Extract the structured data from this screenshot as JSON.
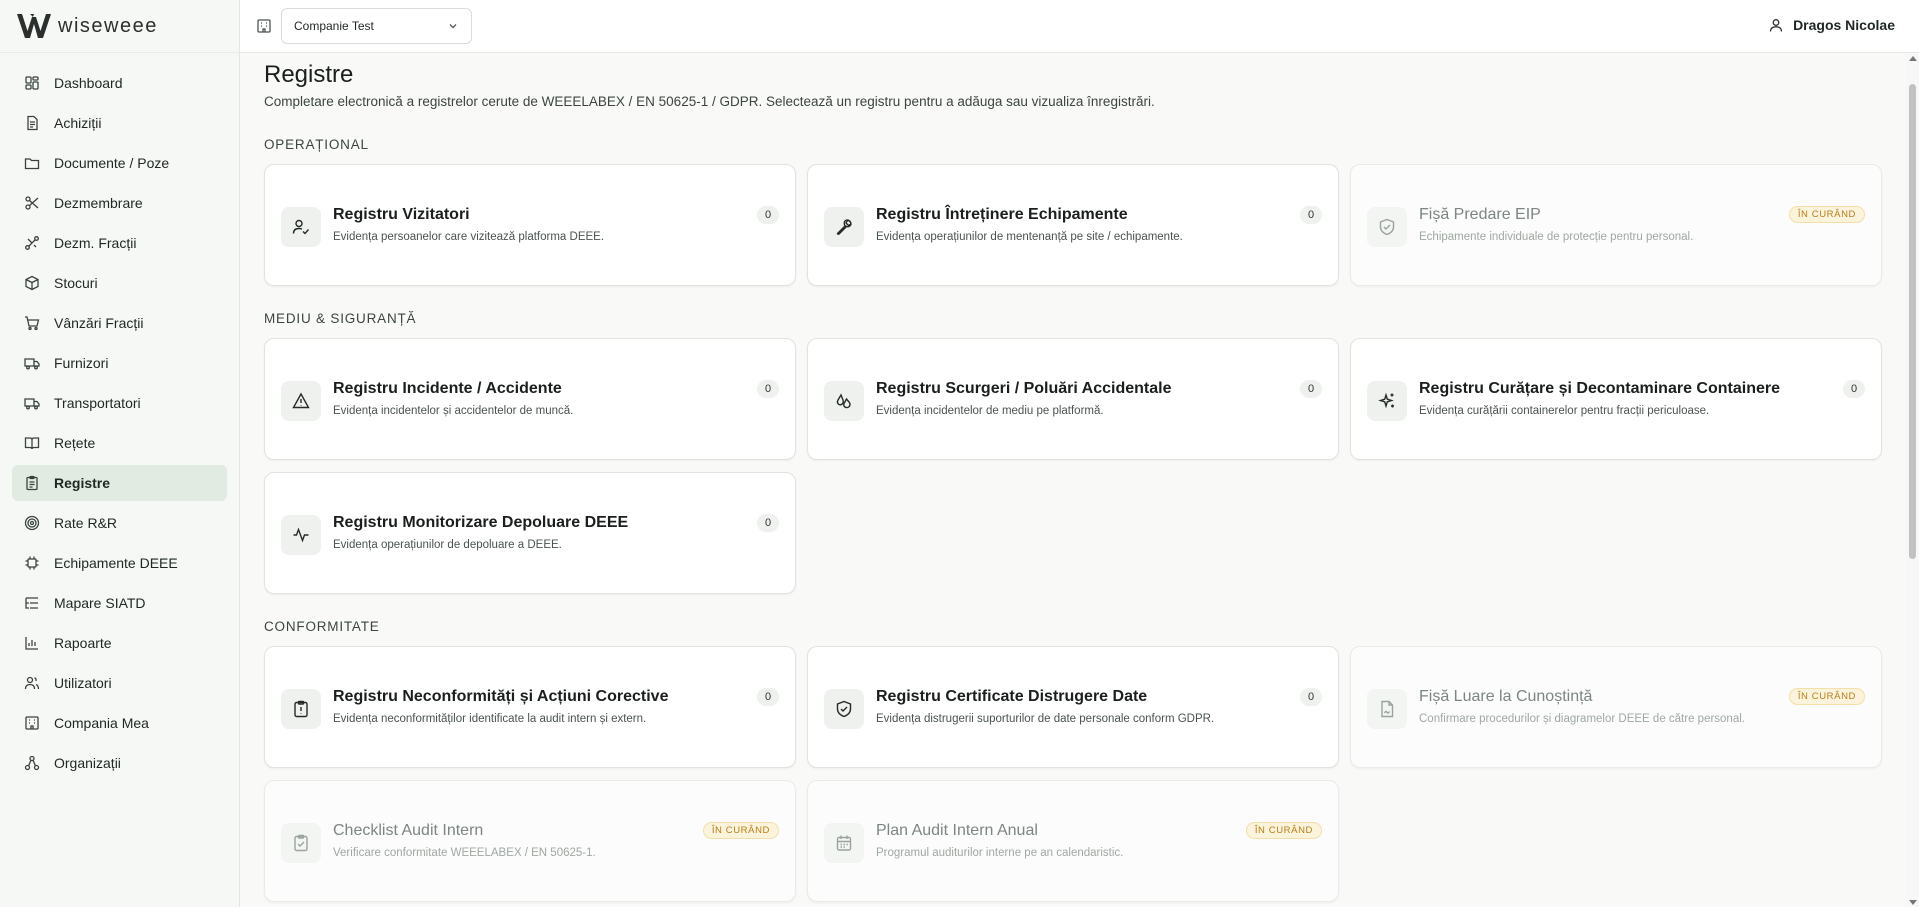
{
  "app": {
    "name": "wiseweee"
  },
  "colors": {
    "active_nav": "#e1ebe1",
    "soon_badge_text": "#b7801a",
    "soon_badge_bg": "#fcf3dc"
  },
  "sidebar": {
    "items": [
      {
        "label": "Dashboard",
        "icon": "dashboard-icon"
      },
      {
        "label": "Achiziții",
        "icon": "document-icon"
      },
      {
        "label": "Documente / Poze",
        "icon": "folder-icon"
      },
      {
        "label": "Dezmembrare",
        "icon": "scissors-icon"
      },
      {
        "label": "Dezm. Fracții",
        "icon": "split-icon"
      },
      {
        "label": "Stocuri",
        "icon": "box-icon"
      },
      {
        "label": "Vânzări Fracții",
        "icon": "cart-icon"
      },
      {
        "label": "Furnizori",
        "icon": "truck-icon"
      },
      {
        "label": "Transportatori",
        "icon": "truck-icon"
      },
      {
        "label": "Rețete",
        "icon": "book-icon"
      },
      {
        "label": "Registre",
        "icon": "clipboard-icon",
        "active": true
      },
      {
        "label": "Rate R&R",
        "icon": "target-icon"
      },
      {
        "label": "Echipamente DEEE",
        "icon": "chip-icon"
      },
      {
        "label": "Mapare SIATD",
        "icon": "list-tree-icon"
      },
      {
        "label": "Rapoarte",
        "icon": "bar-chart-icon"
      },
      {
        "label": "Utilizatori",
        "icon": "users-icon"
      },
      {
        "label": "Compania Mea",
        "icon": "building-icon"
      },
      {
        "label": "Organizații",
        "icon": "network-icon"
      }
    ]
  },
  "header": {
    "company_select": "Companie Test",
    "user_name": "Dragos Nicolae"
  },
  "page": {
    "title": "Registre",
    "subtitle": "Completare electronică a registrelor cerute de WEEELABEX / EN 50625-1 / GDPR. Selectează un registru pentru a adăuga sau vizualiza înregistrări."
  },
  "sections": {
    "operational": "OPERAȚIONAL",
    "mediu": "MEDIU & SIGURANȚĂ",
    "conformitate": "CONFORMITATE"
  },
  "soon_label": "ÎN CURÂND",
  "cards": {
    "vizitatori": {
      "title": "Registru Vizitatori",
      "desc": "Evidența persoanelor care vizitează platforma DEEE.",
      "count": "0",
      "icon": "user-check-icon"
    },
    "intretinere": {
      "title": "Registru Întreținere Echipamente",
      "desc": "Evidența operațiunilor de mentenanță pe site / echipamente.",
      "count": "0",
      "icon": "wrench-icon"
    },
    "eip": {
      "title": "Fișă Predare EIP",
      "desc": "Echipamente individuale de protecție pentru personal.",
      "icon": "shield-check-icon"
    },
    "incidente": {
      "title": "Registru Incidente / Accidente",
      "desc": "Evidența incidentelor și accidentelor de muncă.",
      "count": "0",
      "icon": "warning-icon"
    },
    "scurgeri": {
      "title": "Registru Scurgeri / Poluări Accidentale",
      "desc": "Evidența incidentelor de mediu pe platformă.",
      "count": "0",
      "icon": "droplets-icon"
    },
    "curatare": {
      "title": "Registru Curățare și Decontaminare Containere",
      "desc": "Evidența curățării containerelor pentru fracții periculoase.",
      "count": "0",
      "icon": "sparkles-icon"
    },
    "depoluare": {
      "title": "Registru Monitorizare Depoluare DEEE",
      "desc": "Evidența operațiunilor de depoluare a DEEE.",
      "count": "0",
      "icon": "activity-icon"
    },
    "neconformitati": {
      "title": "Registru Neconformități și Acțiuni Corective",
      "desc": "Evidența neconformităților identificate la audit intern și extern.",
      "count": "0",
      "icon": "clipboard-alert-icon"
    },
    "certificate": {
      "title": "Registru Certificate Distrugere Date",
      "desc": "Evidența distrugerii suporturilor de date personale conform GDPR.",
      "count": "0",
      "icon": "shield-check-icon"
    },
    "cunostinta": {
      "title": "Fișă Luare la Cunoștință",
      "desc": "Confirmare procedurilor și diagramelor DEEE de către personal.",
      "icon": "file-sign-icon"
    },
    "checklist": {
      "title": "Checklist Audit Intern",
      "desc": "Verificare conformitate WEEELABEX / EN 50625-1.",
      "icon": "clipboard-check-icon"
    },
    "plan": {
      "title": "Plan Audit Intern Anual",
      "desc": "Programul auditurilor interne pe an calendaristic.",
      "icon": "calendar-icon"
    }
  }
}
